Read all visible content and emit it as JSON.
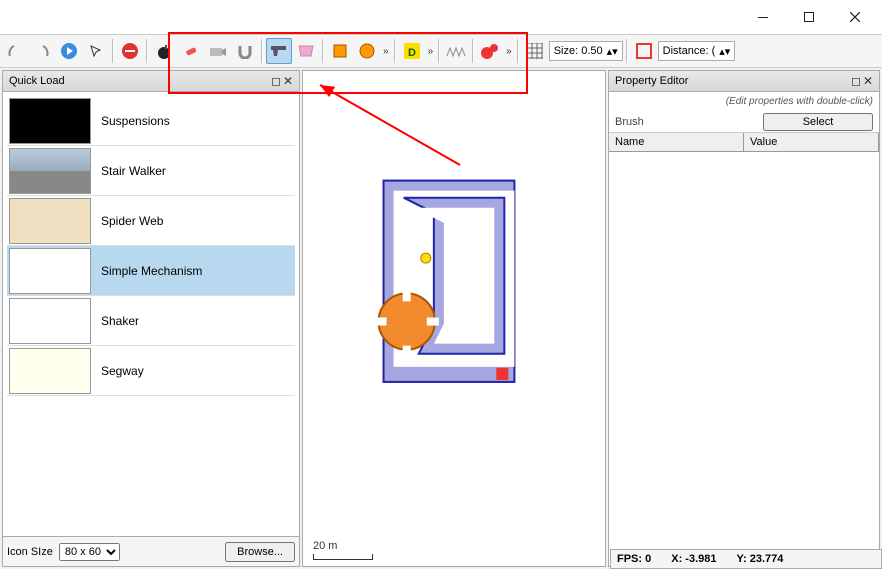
{
  "titlebar": {},
  "toolbar": {
    "size_label": "Size: 0.50",
    "distance_label": "Distance: ("
  },
  "quickload": {
    "title": "Quick Load",
    "items": [
      {
        "label": "Suspensions"
      },
      {
        "label": "Stair Walker"
      },
      {
        "label": "Spider Web"
      },
      {
        "label": "Simple Mechanism"
      },
      {
        "label": "Shaker"
      },
      {
        "label": "Segway"
      }
    ],
    "iconSize_label": "Icon SIze",
    "iconSize_value": "80 x 60",
    "browse_label": "Browse..."
  },
  "property": {
    "title": "Property Editor",
    "hint": "(Edit properties with double-click)",
    "brush_label": "Brush",
    "select_label": "Select",
    "col_name": "Name",
    "col_value": "Value"
  },
  "canvas": {
    "scale_label": "20 m"
  },
  "status": {
    "fps_label": "FPS: 0",
    "x_label": "X: -3.981",
    "y_label": "Y: 23.774"
  }
}
